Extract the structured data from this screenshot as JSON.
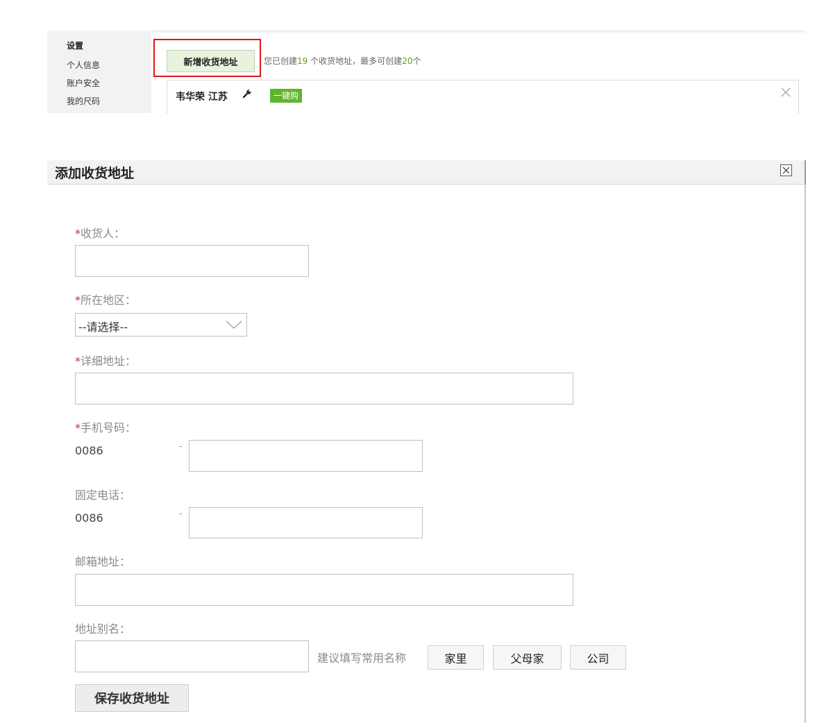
{
  "sidebar": {
    "title": "设置",
    "items": [
      "个人信息",
      "账户安全",
      "我的尺码"
    ]
  },
  "address_toolbar": {
    "add_button_label": "新增收货地址",
    "count_prefix": "您已创建",
    "count_created": "19",
    "count_middle": " 个收货地址，最多可创建",
    "count_max": "20",
    "count_suffix": "个"
  },
  "address_card": {
    "name_region": "韦华荣 江苏",
    "one_click_buy": "一键购",
    "icons": {
      "edit": "wrench-icon",
      "delete": "close-icon"
    }
  },
  "modal": {
    "title": "添加收货地址",
    "required_mark": "*",
    "receiver_label": "收货人：",
    "region_label": "所在地区：",
    "region_value": "--请选择--",
    "detail_label": "详细地址：",
    "mobile_label": "手机号码：",
    "mobile_code": "0086",
    "phone_label": "固定电话：",
    "phone_code": "0086",
    "dash": "-",
    "email_label": "邮箱地址：",
    "alias_label": "地址别名：",
    "alias_hint": "建议填写常用名称",
    "alias_options": [
      "家里",
      "父母家",
      "公司"
    ],
    "save_label": "保存收货地址"
  },
  "colors": {
    "accent_red": "#e0121a",
    "green": "#5fb52b",
    "required": "#d0272c"
  }
}
